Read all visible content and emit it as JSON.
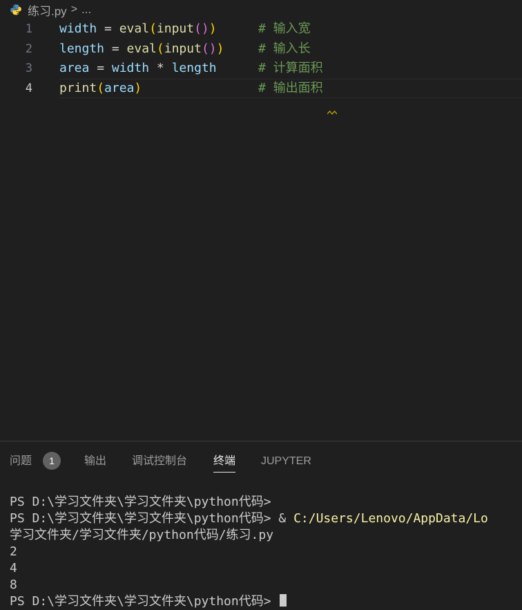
{
  "breadcrumb": {
    "file": "练习.py",
    "separator": ">",
    "more": "..."
  },
  "editor": {
    "lines": [
      {
        "number": "1",
        "tokens": [
          {
            "t": "width",
            "c": "v"
          },
          {
            "t": " = ",
            "c": "o"
          },
          {
            "t": "eval",
            "c": "f"
          },
          {
            "t": "(",
            "c": "p1"
          },
          {
            "t": "input",
            "c": "f"
          },
          {
            "t": "()",
            "c": "p2"
          },
          {
            "t": ")",
            "c": "p1"
          }
        ],
        "comment": "# 输入宽"
      },
      {
        "number": "2",
        "tokens": [
          {
            "t": "length",
            "c": "v"
          },
          {
            "t": " = ",
            "c": "o"
          },
          {
            "t": "eval",
            "c": "f"
          },
          {
            "t": "(",
            "c": "p1"
          },
          {
            "t": "input",
            "c": "f"
          },
          {
            "t": "()",
            "c": "p2"
          },
          {
            "t": ")",
            "c": "p1"
          }
        ],
        "comment": "# 输入长"
      },
      {
        "number": "3",
        "tokens": [
          {
            "t": "area",
            "c": "v"
          },
          {
            "t": " = ",
            "c": "o"
          },
          {
            "t": "width",
            "c": "v"
          },
          {
            "t": " * ",
            "c": "o"
          },
          {
            "t": "length",
            "c": "v"
          }
        ],
        "comment": "# 计算面积"
      },
      {
        "number": "4",
        "tokens": [
          {
            "t": "print",
            "c": "f"
          },
          {
            "t": "(",
            "c": "p1"
          },
          {
            "t": "area",
            "c": "v"
          },
          {
            "t": ")",
            "c": "p1"
          }
        ],
        "comment": "# 输出面积"
      }
    ]
  },
  "panel": {
    "tabs": {
      "problems": "问题",
      "problems_count": "1",
      "output": "输出",
      "debug_console": "调试控制台",
      "terminal": "终端",
      "jupyter": "JUPYTER"
    }
  },
  "terminal": {
    "line1": "PS D:\\学习文件夹\\学习文件夹\\python代码>",
    "line2_prompt": "PS D:\\学习文件夹\\学习文件夹\\python代码> ",
    "line2_amp": "& ",
    "line2_cmd": "C:/Users/Lenovo/AppData/Lo",
    "line3": "学习文件夹/学习文件夹/python代码/练习.py",
    "out1": "2",
    "out2": "4",
    "out3": "8",
    "line_last": "PS D:\\学习文件夹\\学习文件夹\\python代码> "
  },
  "colors": {
    "background": "#1f1f1f",
    "variable": "#9cdcfe",
    "function": "#dcdcaa",
    "comment": "#6a9955",
    "bracket1": "#ffd700",
    "bracket2": "#da70d6",
    "command": "#f9f1a5"
  }
}
